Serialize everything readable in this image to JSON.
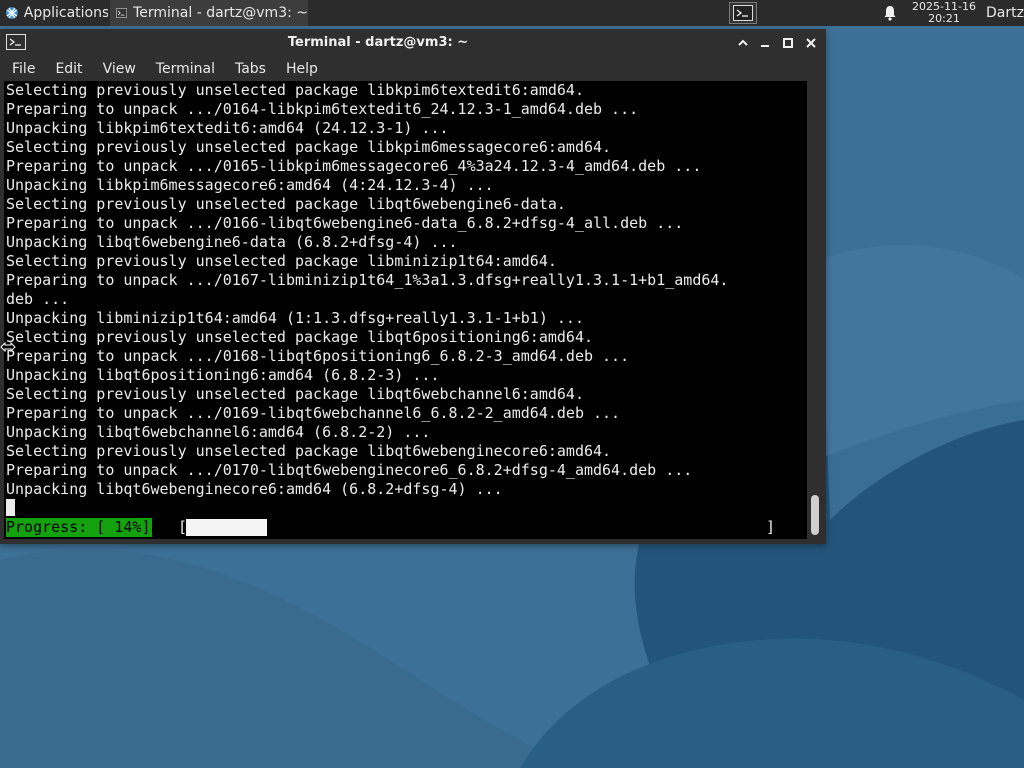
{
  "panel": {
    "applications_label": "Applications",
    "taskbar_label": "Terminal - dartz@vm3: ~",
    "clock_date": "2025-11-16",
    "clock_time": "20:21",
    "user_label": "Dartz"
  },
  "window": {
    "title": "Terminal - dartz@vm3: ~"
  },
  "menu": {
    "file": "File",
    "edit": "Edit",
    "view": "View",
    "terminal": "Terminal",
    "tabs": "Tabs",
    "help": "Help"
  },
  "terminal": {
    "lines": [
      "Selecting previously unselected package libkpim6textedit6:amd64.",
      "Preparing to unpack .../0164-libkpim6textedit6_24.12.3-1_amd64.deb ...",
      "Unpacking libkpim6textedit6:amd64 (24.12.3-1) ...",
      "Selecting previously unselected package libkpim6messagecore6:amd64.",
      "Preparing to unpack .../0165-libkpim6messagecore6_4%3a24.12.3-4_amd64.deb ...",
      "Unpacking libkpim6messagecore6:amd64 (4:24.12.3-4) ...",
      "Selecting previously unselected package libqt6webengine6-data.",
      "Preparing to unpack .../0166-libqt6webengine6-data_6.8.2+dfsg-4_all.deb ...",
      "Unpacking libqt6webengine6-data (6.8.2+dfsg-4) ...",
      "Selecting previously unselected package libminizip1t64:amd64.",
      "Preparing to unpack .../0167-libminizip1t64_1%3a1.3.dfsg+really1.3.1-1+b1_amd64.",
      "deb ...",
      "Unpacking libminizip1t64:amd64 (1:1.3.dfsg+really1.3.1-1+b1) ...",
      "Selecting previously unselected package libqt6positioning6:amd64.",
      "Preparing to unpack .../0168-libqt6positioning6_6.8.2-3_amd64.deb ...",
      "Unpacking libqt6positioning6:amd64 (6.8.2-3) ...",
      "Selecting previously unselected package libqt6webchannel6:amd64.",
      "Preparing to unpack .../0169-libqt6webchannel6_6.8.2-2_amd64.deb ...",
      "Unpacking libqt6webchannel6:amd64 (6.8.2-2) ...",
      "Selecting previously unselected package libqt6webenginecore6:amd64.",
      "Preparing to unpack .../0170-libqt6webenginecore6_6.8.2+dfsg-4_amd64.deb ...",
      "Unpacking libqt6webenginecore6:amd64 (6.8.2+dfsg-4) ..."
    ],
    "progress_label": "Progress: [ 14%]",
    "progress_open": "[",
    "progress_close": "]",
    "progress_fraction": 0.14
  },
  "icons": {
    "applications": "xfce-logo-icon",
    "taskbar": "terminal-icon",
    "panel_launcher": "terminal-icon",
    "notifications": "bell-icon",
    "window": "terminal-icon",
    "controls": [
      "chevron-up-icon",
      "minimize-icon",
      "maximize-icon",
      "close-icon"
    ]
  },
  "colors": {
    "panel_bg": "#2b2b2b",
    "window_bg": "#2f2f2f",
    "terminal_bg": "#000000",
    "terminal_fg": "#ececec",
    "progress_label_bg": "#13a10e",
    "desktop_bg": "#3a6f94"
  }
}
